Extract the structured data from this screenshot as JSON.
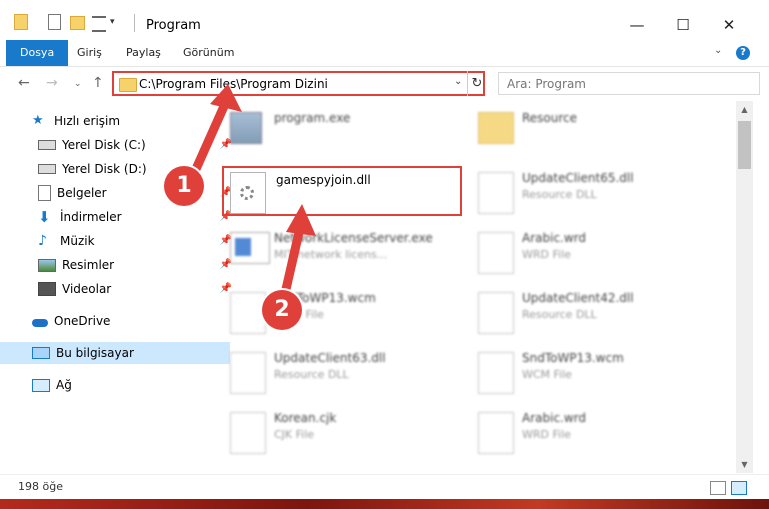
{
  "window": {
    "title": "Program",
    "controls": {
      "minimize": "—",
      "maximize": "☐",
      "close": "✕"
    }
  },
  "ribbon": {
    "tabs": [
      "Dosya",
      "Giriş",
      "Paylaş",
      "Görünüm"
    ],
    "help": "?"
  },
  "address": {
    "path": "C:\\Program Files\\Program Dizini",
    "search_placeholder": "Ara: Program"
  },
  "sidebar": {
    "quick_access": "Hızlı erişim",
    "items": [
      {
        "label": "Yerel Disk (C:)",
        "icon": "drive-icon"
      },
      {
        "label": "Yerel Disk (D:)",
        "icon": "drive-icon"
      },
      {
        "label": "Belgeler",
        "icon": "documents-icon"
      },
      {
        "label": "İndirmeler",
        "icon": "download-icon"
      },
      {
        "label": "Müzik",
        "icon": "music-icon"
      },
      {
        "label": "Resimler",
        "icon": "pictures-icon"
      },
      {
        "label": "Videolar",
        "icon": "video-icon"
      }
    ],
    "onedrive": "OneDrive",
    "this_pc": "Bu bilgisayar",
    "network": "Ağ"
  },
  "files": [
    {
      "name": "program.exe",
      "type": ""
    },
    {
      "name": "Resource",
      "type": ""
    },
    {
      "name": "gamespyjoin.dll",
      "type": ""
    },
    {
      "name": "UpdateClient65.dll",
      "type": "Resource DLL"
    },
    {
      "name": "NetworkLicenseServer.exe",
      "type": "MIT network licens..."
    },
    {
      "name": "Arabic.wrd",
      "type": "WRD File"
    },
    {
      "name": "SndToWP13.wcm",
      "type": "WCM File"
    },
    {
      "name": "UpdateClient42.dll",
      "type": "Resource DLL"
    },
    {
      "name": "UpdateClient63.dll",
      "type": "Resource DLL"
    },
    {
      "name": "SndToWP13.wcm",
      "type": "WCM File"
    },
    {
      "name": "Korean.cjk",
      "type": "CJK File"
    },
    {
      "name": "Arabic.wrd",
      "type": "WRD File"
    }
  ],
  "status": {
    "count": "198 öğe"
  },
  "annotations": {
    "step1": "1",
    "step2": "2"
  }
}
